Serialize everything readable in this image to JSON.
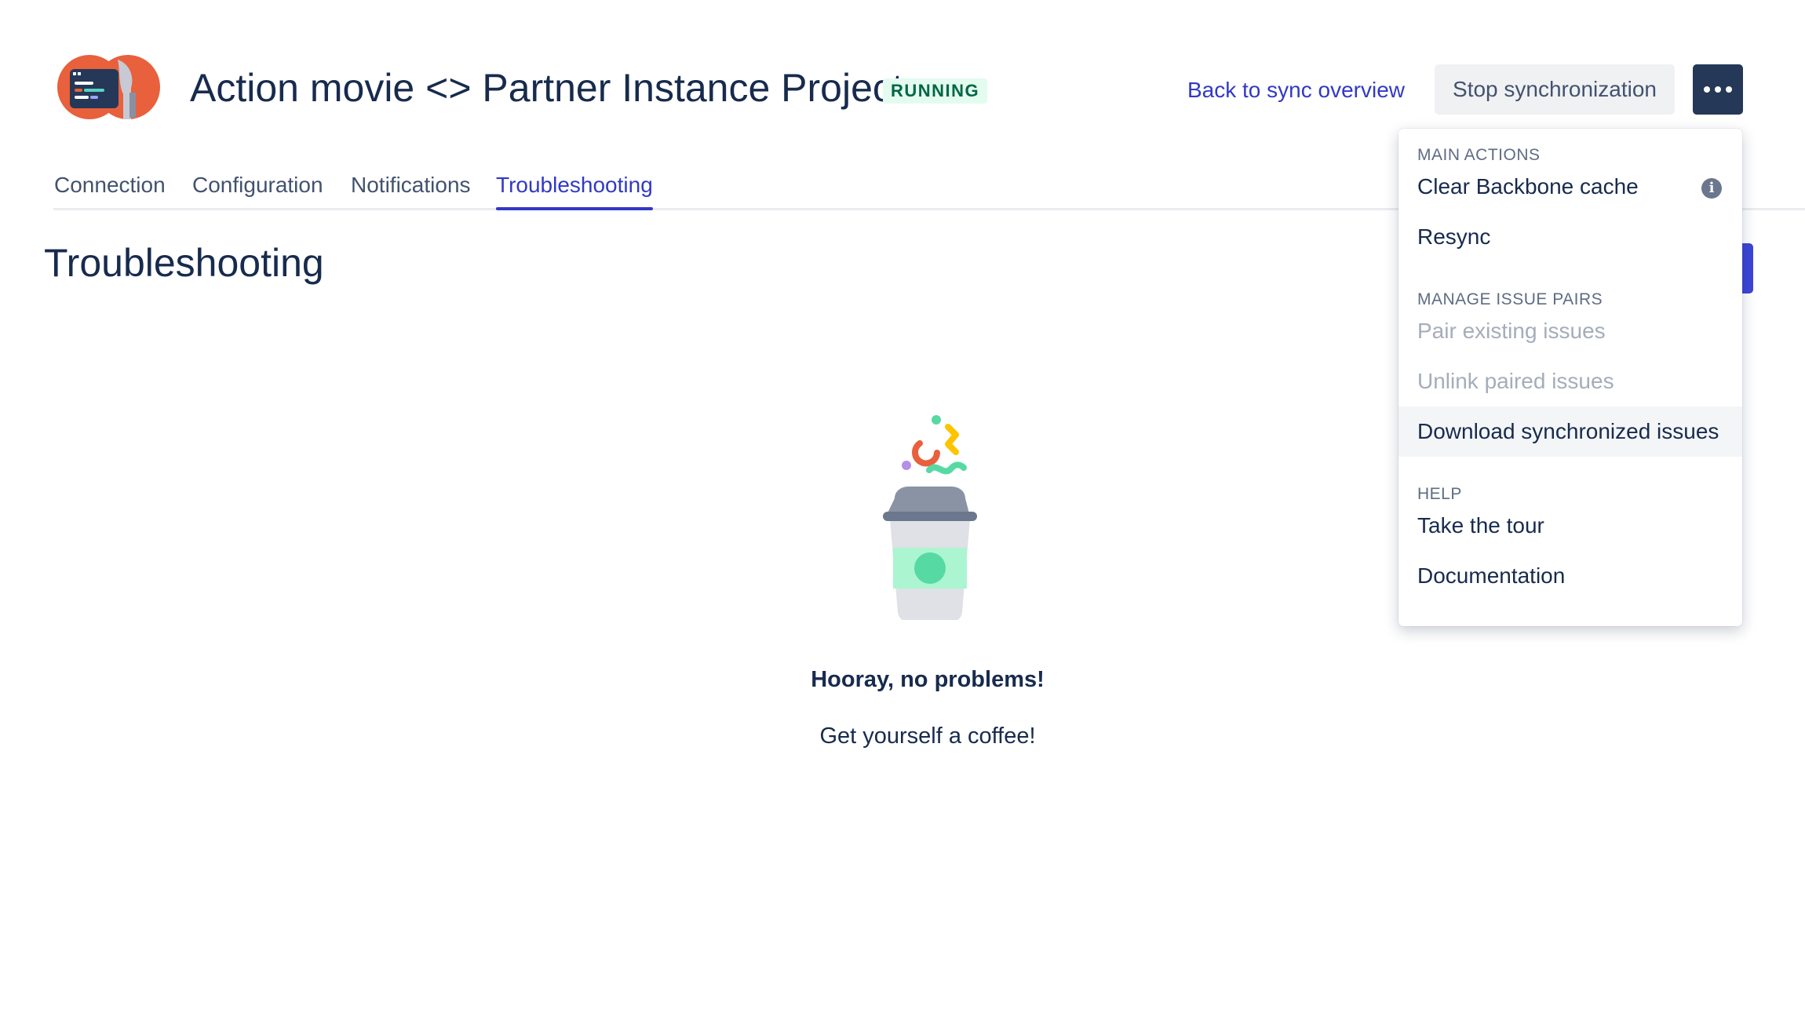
{
  "header": {
    "title": "Action movie <> Partner Instance Project",
    "status_badge": "RUNNING",
    "back_link": "Back to sync overview",
    "stop_button": "Stop synchronization"
  },
  "tabs": [
    {
      "label": "Connection"
    },
    {
      "label": "Configuration"
    },
    {
      "label": "Notifications"
    },
    {
      "label": "Troubleshooting",
      "active": true
    }
  ],
  "page": {
    "title": "Troubleshooting",
    "empty_title": "Hooray, no problems!",
    "empty_subtitle": "Get yourself a coffee!"
  },
  "menu": {
    "group_main": "MAIN ACTIONS",
    "clear_cache": "Clear Backbone cache",
    "resync": "Resync",
    "group_manage": "MANAGE ISSUE PAIRS",
    "pair_existing": "Pair existing issues",
    "unlink_paired": "Unlink paired issues",
    "download_synced": "Download synchronized issues",
    "group_help": "HELP",
    "take_tour": "Take the tour",
    "documentation": "Documentation"
  },
  "icons": {
    "more": "more-horizontal-icon",
    "info": "info-icon",
    "logo": "app-logo-icon",
    "illustration": "coffee-cup-illustration"
  },
  "colors": {
    "accent": "#3139c5",
    "running_bg": "#e3fcef",
    "running_text": "#006644",
    "more_button_bg": "#253858"
  }
}
